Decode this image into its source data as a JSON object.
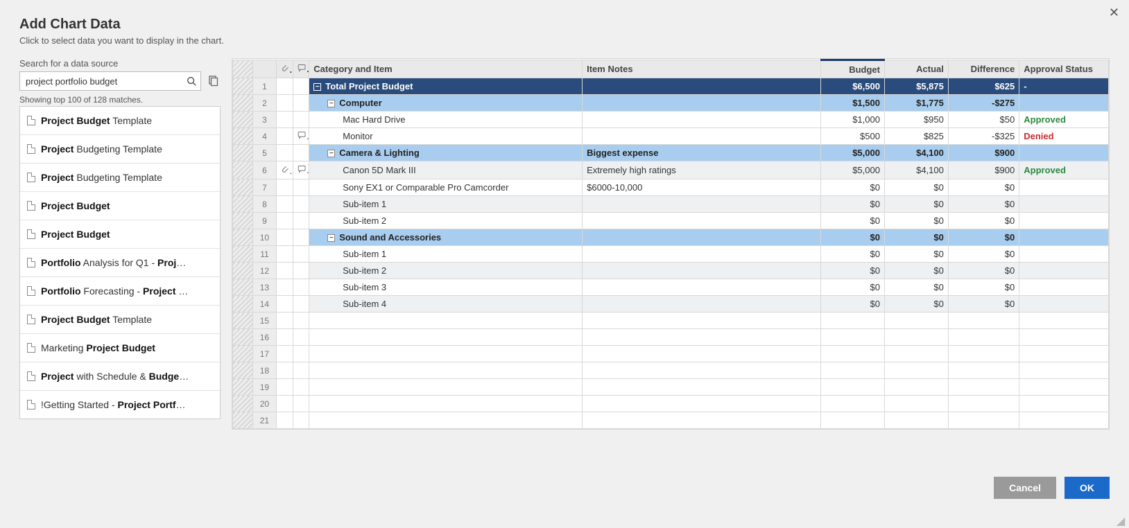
{
  "header": {
    "title": "Add Chart Data",
    "subtitle": "Click to select data you want to display in the chart."
  },
  "search": {
    "label": "Search for a data source",
    "value": "project portfolio budget",
    "showing": "Showing top 100 of 128 matches."
  },
  "results": [
    {
      "html": "<b>Project Budget</b> Template"
    },
    {
      "html": "<b>Project</b> Budgeting Template"
    },
    {
      "html": "<b>Project</b> Budgeting Template"
    },
    {
      "html": "<b>Project Budget</b>"
    },
    {
      "html": "<b>Project Budget</b>"
    },
    {
      "html": "<b>Portfolio</b> Analysis for Q1 - <b>Proj</b>…"
    },
    {
      "html": "<b>Portfolio</b> Forecasting - <b>Project</b> …"
    },
    {
      "html": "<b>Project Budget</b> Template"
    },
    {
      "html": "Marketing <b>Project Budget</b>"
    },
    {
      "html": "<b>Project</b> with Schedule & <b>Budge</b>…"
    },
    {
      "html": "!Getting Started - <b>Project Portf</b>…"
    }
  ],
  "grid": {
    "columns": {
      "category": "Category and Item",
      "notes": "Item Notes",
      "budget": "Budget",
      "actual": "Actual",
      "difference": "Difference",
      "approval": "Approval Status"
    },
    "rows": [
      {
        "n": 1,
        "kind": "total",
        "cat": "Total Project Budget",
        "notes": "",
        "budget": "$6,500",
        "actual": "$5,875",
        "diff": "$625",
        "appr": "-"
      },
      {
        "n": 2,
        "kind": "sub",
        "cat": "Computer",
        "notes": "",
        "budget": "$1,500",
        "actual": "$1,775",
        "diff": "-$275",
        "appr": ""
      },
      {
        "n": 3,
        "kind": "item",
        "cat": "Mac Hard Drive",
        "notes": "",
        "budget": "$1,000",
        "actual": "$950",
        "diff": "$50",
        "appr": "Approved"
      },
      {
        "n": 4,
        "kind": "item",
        "cat": "Monitor",
        "notes": "",
        "budget": "$500",
        "actual": "$825",
        "diff": "-$325",
        "appr": "Denied",
        "comment": true
      },
      {
        "n": 5,
        "kind": "sub",
        "cat": "Camera & Lighting",
        "notes": "Biggest expense",
        "budget": "$5,000",
        "actual": "$4,100",
        "diff": "$900",
        "appr": ""
      },
      {
        "n": 6,
        "kind": "item-alt",
        "cat": "Canon 5D Mark III",
        "notes": "Extremely high ratings",
        "budget": "$5,000",
        "actual": "$4,100",
        "diff": "$900",
        "appr": "Approved",
        "attach": true,
        "comment": true
      },
      {
        "n": 7,
        "kind": "item",
        "cat": "Sony EX1 or Comparable Pro Camcorder",
        "notes": "$6000-10,000",
        "budget": "$0",
        "actual": "$0",
        "diff": "$0",
        "appr": ""
      },
      {
        "n": 8,
        "kind": "item-alt",
        "cat": "Sub-item 1",
        "notes": "",
        "budget": "$0",
        "actual": "$0",
        "diff": "$0",
        "appr": ""
      },
      {
        "n": 9,
        "kind": "item",
        "cat": "Sub-item 2",
        "notes": "",
        "budget": "$0",
        "actual": "$0",
        "diff": "$0",
        "appr": ""
      },
      {
        "n": 10,
        "kind": "sub",
        "cat": "Sound and Accessories",
        "notes": "",
        "budget": "$0",
        "actual": "$0",
        "diff": "$0",
        "appr": ""
      },
      {
        "n": 11,
        "kind": "item",
        "cat": "Sub-item 1",
        "notes": "",
        "budget": "$0",
        "actual": "$0",
        "diff": "$0",
        "appr": ""
      },
      {
        "n": 12,
        "kind": "item-alt",
        "cat": "Sub-item 2",
        "notes": "",
        "budget": "$0",
        "actual": "$0",
        "diff": "$0",
        "appr": ""
      },
      {
        "n": 13,
        "kind": "item",
        "cat": "Sub-item 3",
        "notes": "",
        "budget": "$0",
        "actual": "$0",
        "diff": "$0",
        "appr": ""
      },
      {
        "n": 14,
        "kind": "item-alt",
        "cat": "Sub-item 4",
        "notes": "",
        "budget": "$0",
        "actual": "$0",
        "diff": "$0",
        "appr": ""
      },
      {
        "n": 15,
        "kind": "empty"
      },
      {
        "n": 16,
        "kind": "empty"
      },
      {
        "n": 17,
        "kind": "empty"
      },
      {
        "n": 18,
        "kind": "empty"
      },
      {
        "n": 19,
        "kind": "empty"
      },
      {
        "n": 20,
        "kind": "empty"
      },
      {
        "n": 21,
        "kind": "empty"
      }
    ]
  },
  "footer": {
    "cancel": "Cancel",
    "ok": "OK"
  }
}
